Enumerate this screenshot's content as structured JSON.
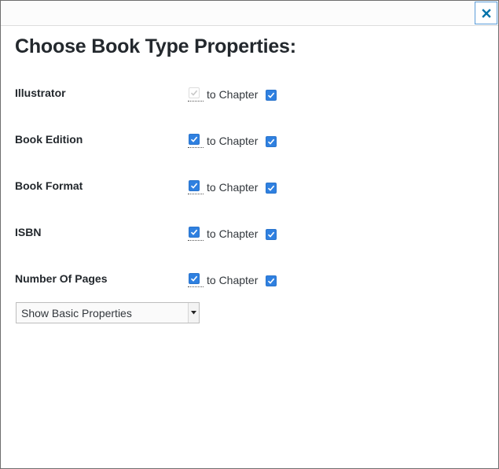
{
  "dialog": {
    "close_icon": "close-icon",
    "title": "Choose Book Type Properties:"
  },
  "properties": [
    {
      "label": "Illustrator",
      "checked": true,
      "disabled": true,
      "chapter_label": "to Chapter",
      "chapter_checked": true
    },
    {
      "label": "Book Edition",
      "checked": true,
      "disabled": false,
      "chapter_label": "to Chapter",
      "chapter_checked": true
    },
    {
      "label": "Book Format",
      "checked": true,
      "disabled": false,
      "chapter_label": "to Chapter",
      "chapter_checked": true
    },
    {
      "label": "ISBN",
      "checked": true,
      "disabled": false,
      "chapter_label": "to Chapter",
      "chapter_checked": true
    },
    {
      "label": "Number Of Pages",
      "checked": true,
      "disabled": false,
      "chapter_label": "to Chapter",
      "chapter_checked": true
    }
  ],
  "properties_select": {
    "value": "Show Basic Properties",
    "arrow_icon": "caret-down-icon"
  },
  "colors": {
    "accent": "#2f80e0",
    "close_accent": "#0073aa",
    "text": "#23282d"
  }
}
